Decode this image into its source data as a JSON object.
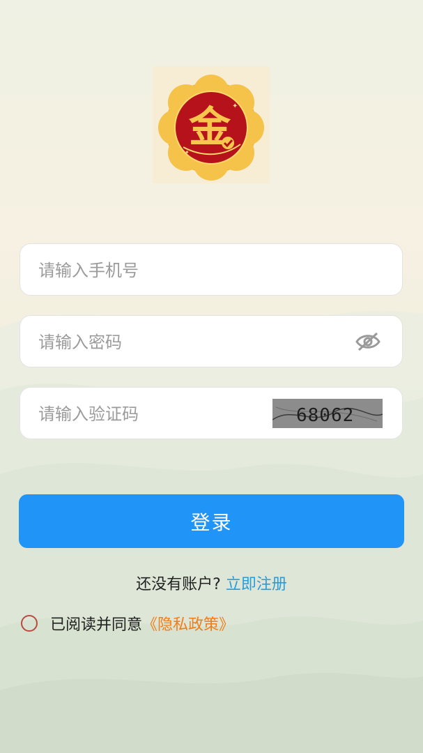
{
  "logo": {
    "glyph": "金",
    "colors": {
      "red": "#b5121b",
      "gold": "#f5c24a",
      "bg": "#f7ecd4"
    }
  },
  "form": {
    "phone_placeholder": "请输入手机号",
    "password_placeholder": "请输入密码",
    "captcha_placeholder": "请输入验证码",
    "captcha_text": "68062"
  },
  "login_button": "登录",
  "register": {
    "prompt": "还没有账户?",
    "link": "立即注册"
  },
  "agreement": {
    "text": "已阅读并同意",
    "link": "《隐私政策》"
  },
  "colors": {
    "primary": "#2095f7",
    "link_blue": "#2b9bd8",
    "link_orange": "#ef7d1a",
    "radio_border": "#b84a3f"
  }
}
